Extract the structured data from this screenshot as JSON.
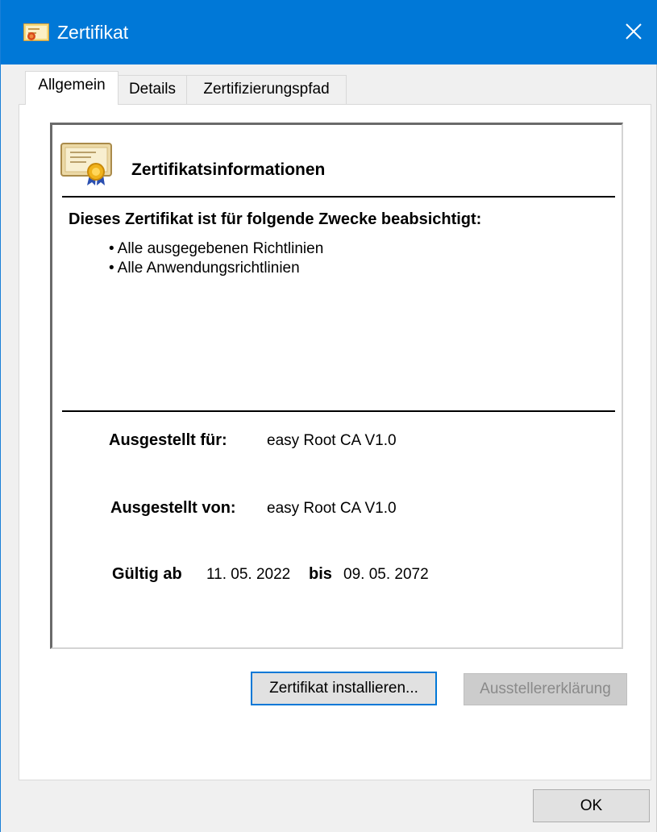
{
  "window": {
    "title": "Zertifikat",
    "icon": "certificate-icon",
    "close_icon": "close-icon",
    "colors": {
      "titlebar": "#0078d7",
      "accent": "#0078d7",
      "background": "#f0f0f0"
    }
  },
  "tabs": [
    {
      "label": "Allgemein",
      "selected": true
    },
    {
      "label": "Details",
      "selected": false
    },
    {
      "label": "Zertifizierungspfad",
      "selected": false
    }
  ],
  "general": {
    "icon": "certificate-icon",
    "heading": "Zertifikatsinformationen",
    "purpose_heading": "Dieses Zertifikat ist für folgende Zwecke beabsichtigt:",
    "purposes": [
      "Alle ausgegebenen Richtlinien",
      "Alle Anwendungsrichtlinien"
    ],
    "issued_to": {
      "label": "Ausgestellt für:",
      "value": "easy Root CA V1.0"
    },
    "issued_by": {
      "label": "Ausgestellt von:",
      "value": "easy Root CA V1.0"
    },
    "validity": {
      "valid_from_label": "Gültig ab",
      "valid_from": "11. 05. 2022",
      "until_label": "bis",
      "valid_to": "09. 05. 2072"
    }
  },
  "buttons": {
    "install": "Zertifikat installieren...",
    "issuer_statement": "Ausstellererklärung",
    "issuer_statement_enabled": false,
    "ok": "OK"
  }
}
